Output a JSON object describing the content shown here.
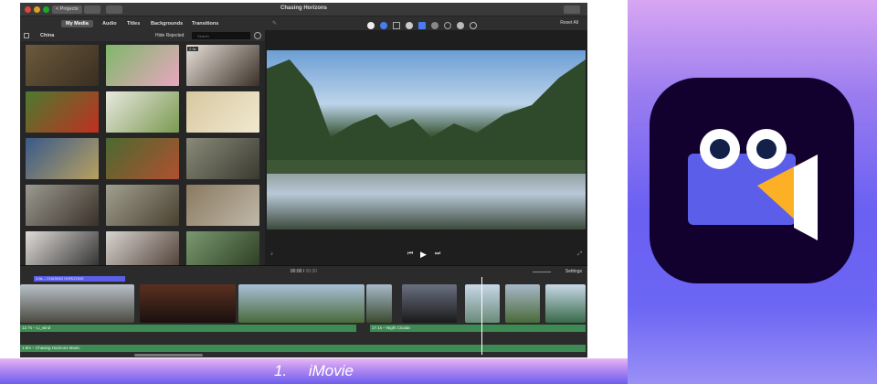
{
  "window": {
    "title": "Chasing Horizons",
    "projects_label": "< Projects",
    "reset_all": "Reset All"
  },
  "toolbar": {
    "tabs": [
      "My Media",
      "Audio",
      "Titles",
      "Backgrounds",
      "Transitions"
    ]
  },
  "browser": {
    "section": "China",
    "hide_rejected": "Hide Rejected",
    "search_placeholder": "Search",
    "badge": "2.9s"
  },
  "viewer": {
    "timecode_current": "00:00",
    "timecode_total": "00:30"
  },
  "timeline": {
    "settings": "Settings",
    "title_clip": "3.8s – CHASING HORIZONS",
    "audio_1": "12.7s – Li_wind",
    "audio_2": "17.1s – Night Cicada",
    "music": "1.8m – Chasing Horizons Music"
  },
  "caption": {
    "number": "1.",
    "text": "iMovie"
  },
  "colors": {
    "accent": "#4a7cf0",
    "audio": "#3d8a55",
    "icon_bg": "#12002e",
    "icon_body": "#5b5ee8",
    "icon_cone": "#fbb025"
  }
}
